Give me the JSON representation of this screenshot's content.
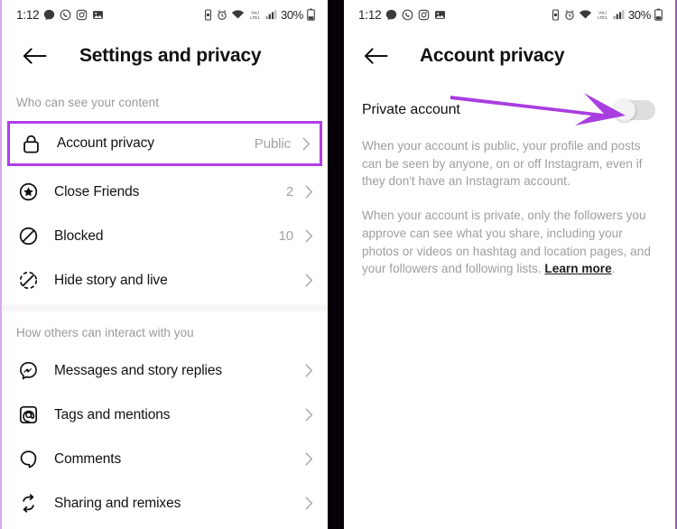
{
  "colors": {
    "highlight_purple": "#b23ce8",
    "arrow_purple": "#a93ee0",
    "frame_purple": "#9b59b6",
    "muted_text": "#9e9e9e",
    "chevron": "#b2b2b2"
  },
  "status_bar": {
    "time": "1:12",
    "battery_percent": "30%",
    "left_icons": [
      "messenger-chat-icon",
      "whatsapp-icon",
      "instagram-icon",
      "gallery-icon"
    ],
    "right_icons": [
      "vibrate-icon",
      "alarm-icon",
      "wifi-icon",
      "volte-icon",
      "signal-bars-icon",
      "battery-icon"
    ]
  },
  "left_screen": {
    "header": {
      "title": "Settings and privacy",
      "back_icon": "back-arrow-icon"
    },
    "sections": [
      {
        "label": "Who can see your content",
        "items": [
          {
            "icon": "lock-icon",
            "label": "Account privacy",
            "value": "Public",
            "highlighted": true
          },
          {
            "icon": "close-friends-star-icon",
            "label": "Close Friends",
            "value": "2",
            "highlighted": false
          },
          {
            "icon": "blocked-icon",
            "label": "Blocked",
            "value": "10",
            "highlighted": false
          },
          {
            "icon": "hide-story-icon",
            "label": "Hide story and live",
            "value": "",
            "highlighted": false
          }
        ]
      },
      {
        "label": "How others can interact with you",
        "items": [
          {
            "icon": "messenger-icon",
            "label": "Messages and story replies",
            "value": "",
            "highlighted": false
          },
          {
            "icon": "at-mention-icon",
            "label": "Tags and mentions",
            "value": "",
            "highlighted": false
          },
          {
            "icon": "comment-icon",
            "label": "Comments",
            "value": "",
            "highlighted": false
          },
          {
            "icon": "remix-icon",
            "label": "Sharing and remixes",
            "value": "",
            "highlighted": false
          }
        ]
      }
    ]
  },
  "right_screen": {
    "header": {
      "title": "Account privacy",
      "back_icon": "back-arrow-icon"
    },
    "toggle": {
      "label": "Private account",
      "state": "off"
    },
    "paragraph_1": "When your account is public, your profile and posts can be seen by anyone, on or off Instagram, even if they don't have an Instagram account.",
    "paragraph_2": "When your account is private, only the followers you approve can see what you share, including your photos or videos on hashtag and location pages, and your followers and following lists. ",
    "learn_more": "Learn more",
    "paragraph_2_end": "."
  },
  "annotation": {
    "arrow": "purple-arrow-pointing-to-toggle"
  }
}
